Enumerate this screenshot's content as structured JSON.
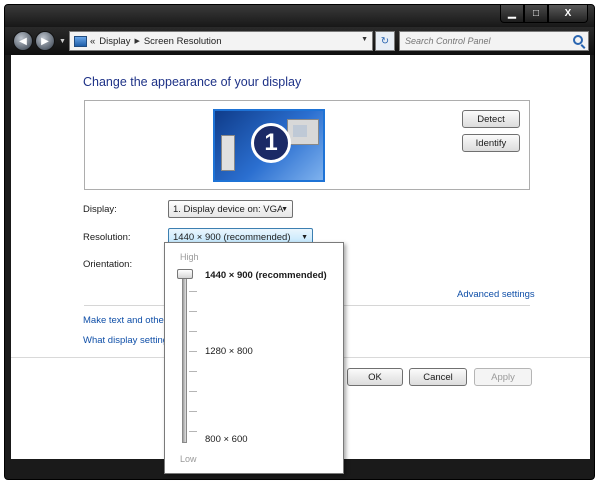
{
  "window": {
    "minimize_glyph": "▁",
    "maximize_glyph": "□",
    "close_glyph": "X"
  },
  "nav": {
    "back_glyph": "◀",
    "forward_glyph": "▶",
    "breadcrumb": [
      "Display",
      "Screen Resolution"
    ],
    "breadcrumb_lead": "«",
    "breadcrumb_sep": "▶",
    "refresh_glyph": "↻",
    "search_placeholder": "Search Control Panel"
  },
  "heading": "Change the appearance of your display",
  "monitor_number": "1",
  "buttons": {
    "detect": "Detect",
    "identify": "Identify",
    "ok": "OK",
    "cancel": "Cancel",
    "apply": "Apply"
  },
  "fields": {
    "display_label": "Display:",
    "display_value": "1. Display device on: VGA",
    "resolution_label": "Resolution:",
    "resolution_value": "1440 × 900 (recommended)",
    "orientation_label": "Orientation:"
  },
  "links": {
    "advanced": "Advanced settings",
    "text_size": "Make text and other",
    "what_settings": "What display setting"
  },
  "slider": {
    "high_label": "High",
    "low_label": "Low",
    "options": [
      "1440 × 900 (recommended)",
      "1280 × 800",
      "800 × 600"
    ],
    "selected": "1440 × 900 (recommended)"
  }
}
